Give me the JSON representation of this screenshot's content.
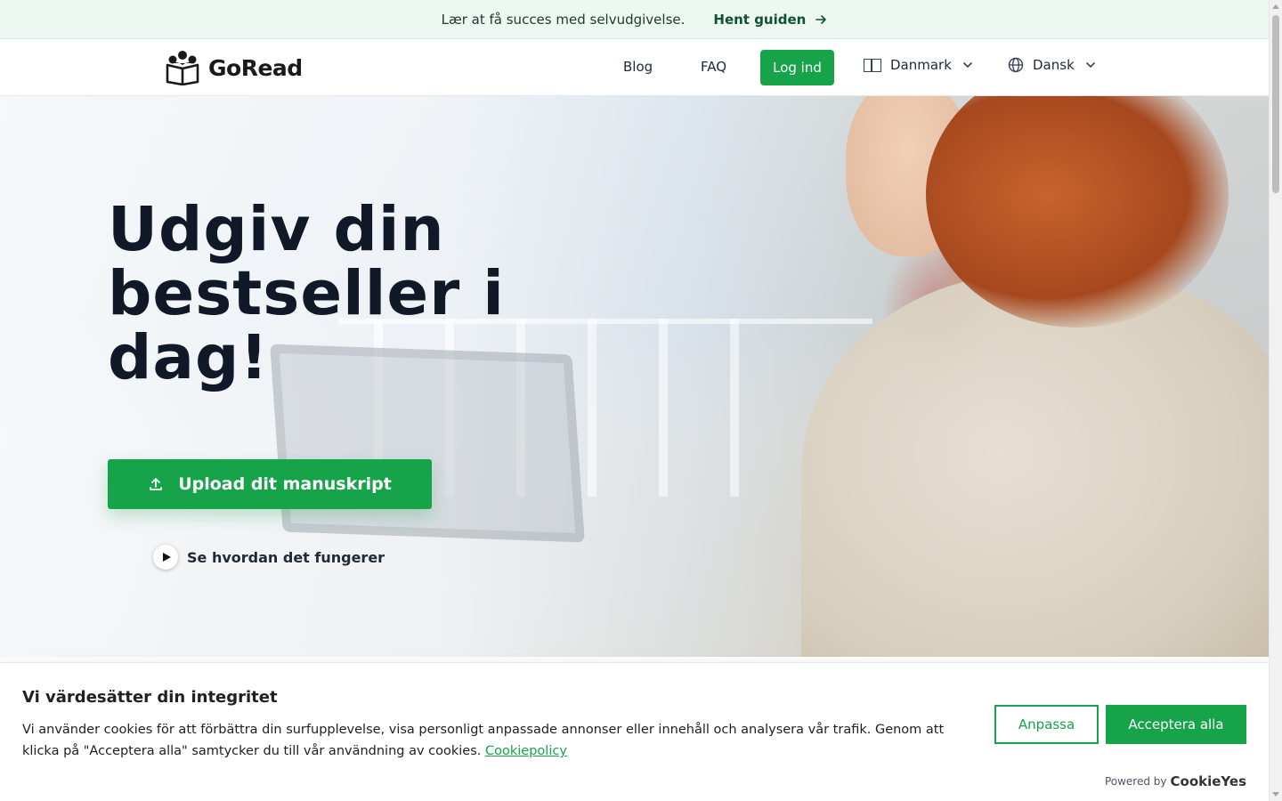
{
  "announcement": {
    "message": "Lær at få succes med selvudgivelse.",
    "link_label": "Hent guiden"
  },
  "header": {
    "brand_name": "GoRead",
    "nav": {
      "blog": "Blog",
      "faq": "FAQ"
    },
    "login_label": "Log ind",
    "country_selector": "Danmark",
    "language_selector": "Dansk"
  },
  "hero": {
    "title": "Udgiv din bestseller i dag!",
    "upload_button": "Upload dit manuskript",
    "how_it_works": "Se hvordan det fungerer"
  },
  "cookie_banner": {
    "title": "Vi värdesätter din integritet",
    "text": "Vi använder cookies för att förbättra din surfupplevelse, visa personligt anpassade annonser eller innehåll och analysera vår trafik. Genom att klicka på \"Acceptera alla\" samtycker du till vår användning av cookies.",
    "policy_link": "Cookiepolicy",
    "customize_button": "Anpassa",
    "accept_button": "Acceptera alla",
    "powered_by": "Powered by",
    "powered_brand": "CookieYes"
  },
  "colors": {
    "accent": "#16a34a",
    "announcement_bg": "#ecf8f1",
    "heading": "#111827"
  }
}
